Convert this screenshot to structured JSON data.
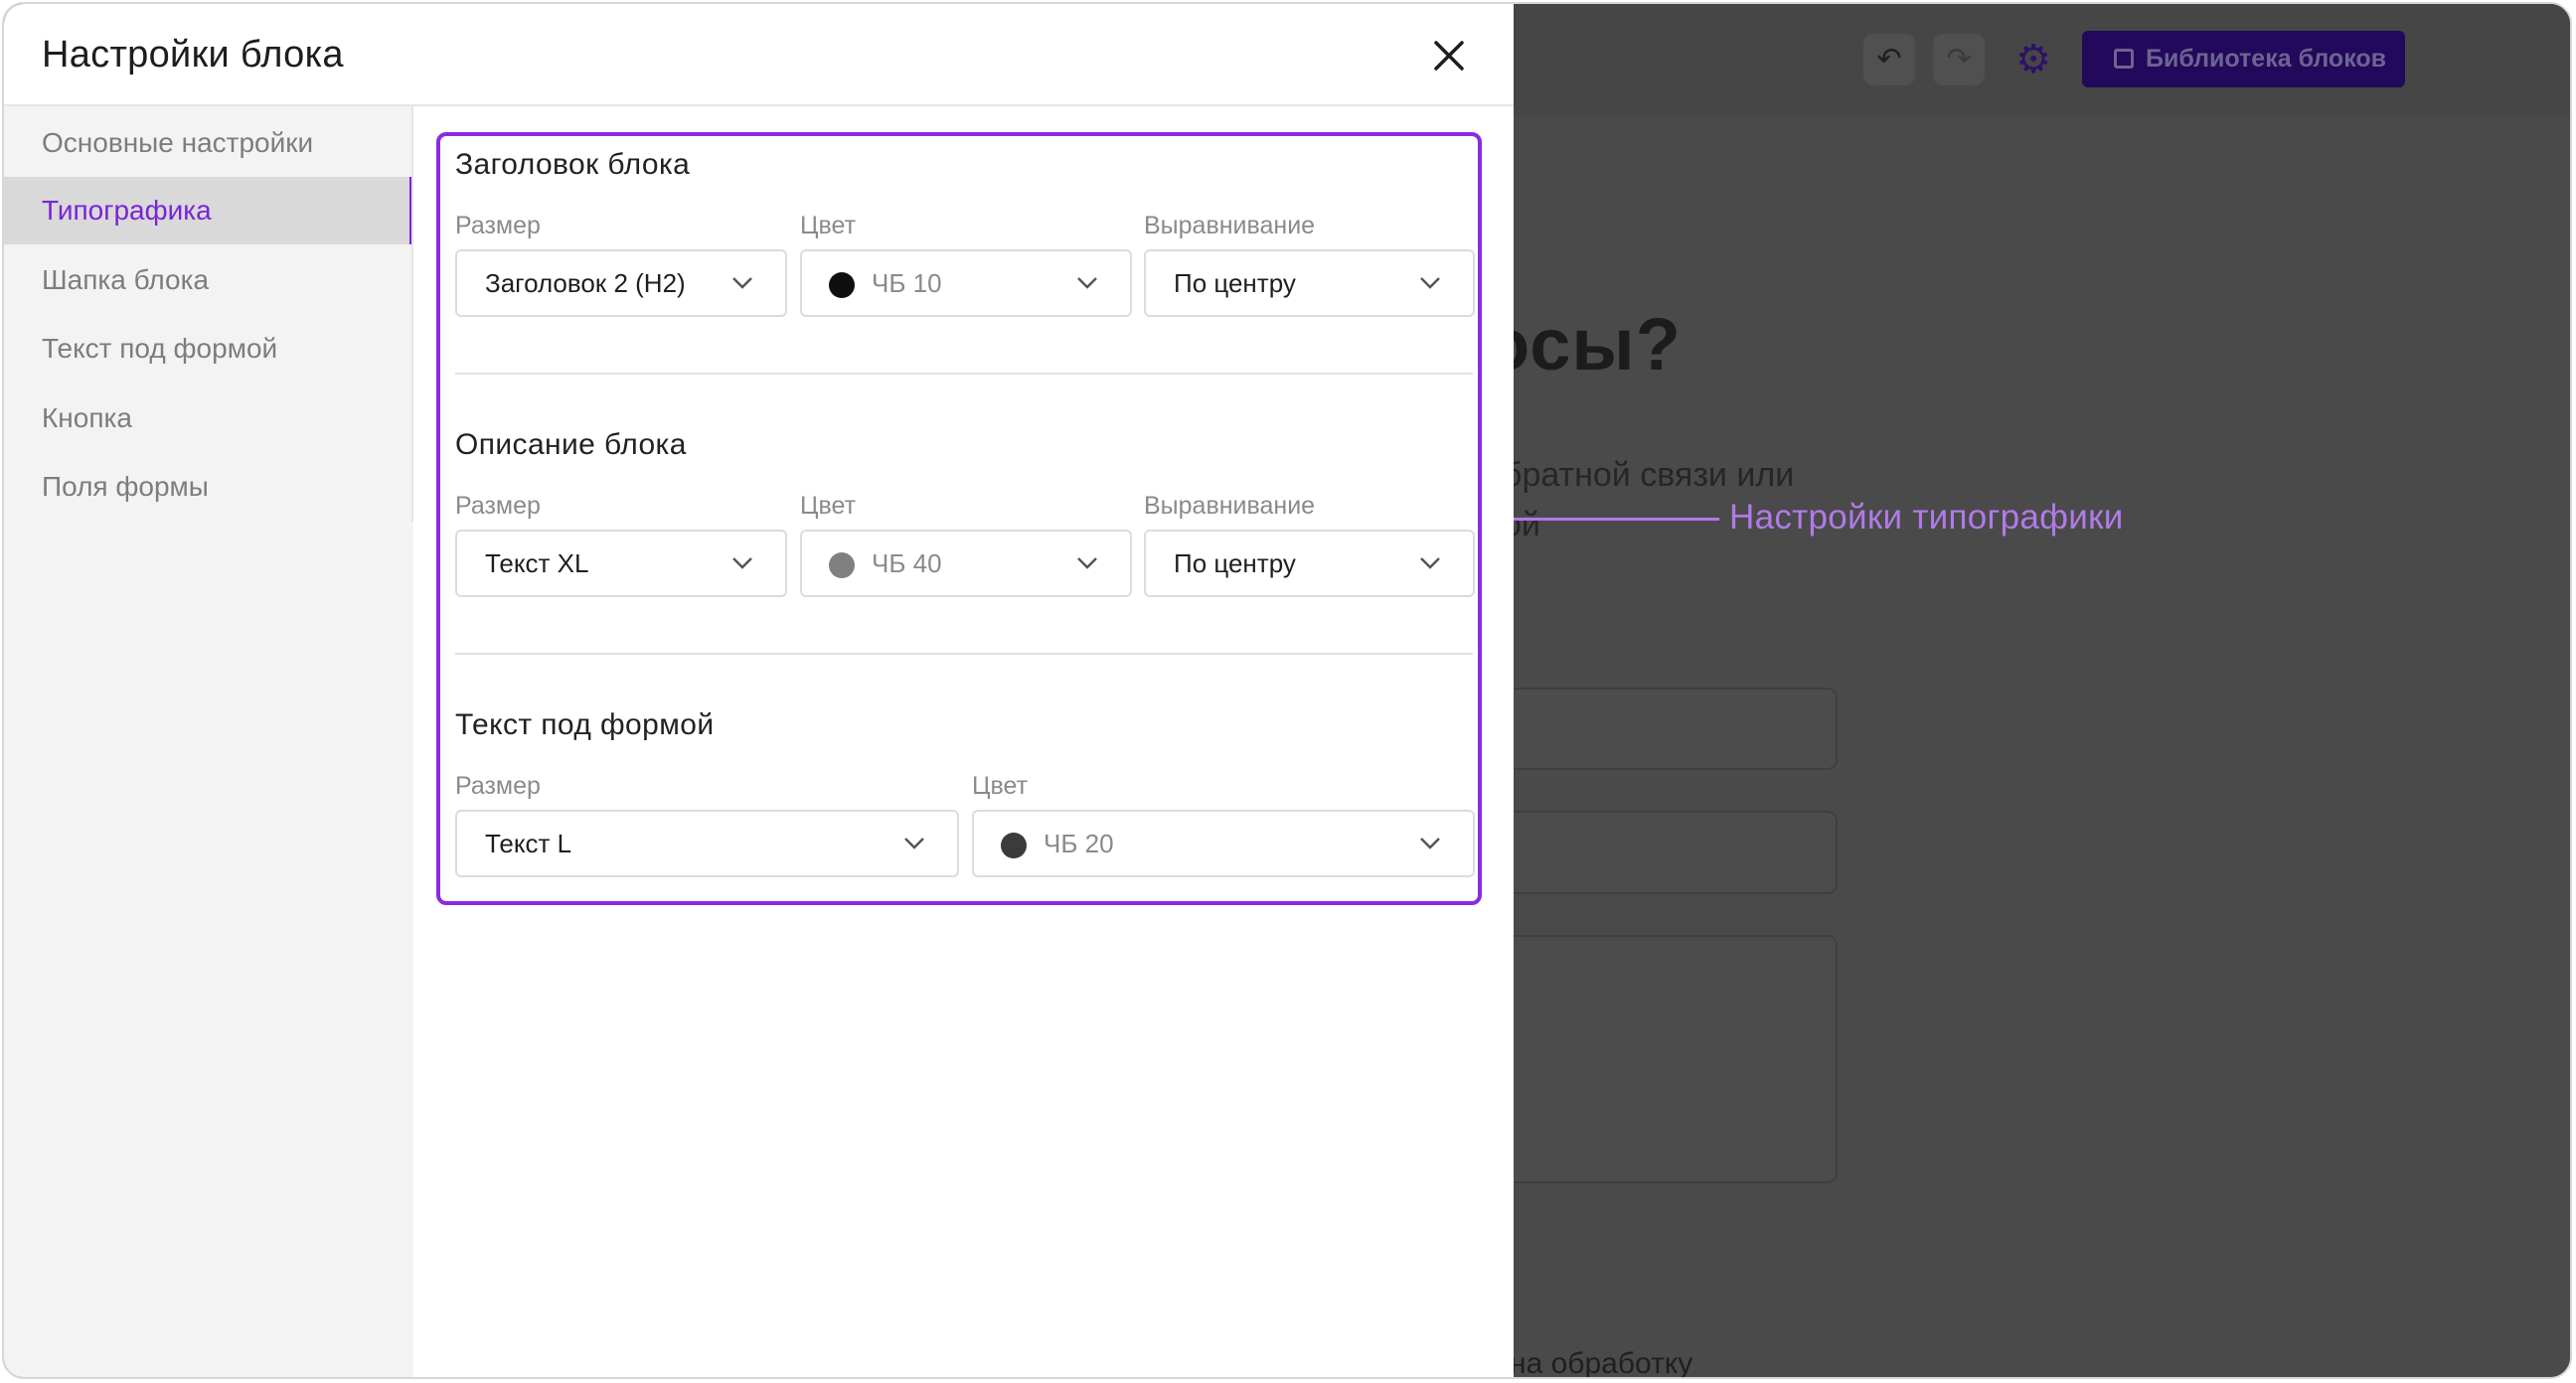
{
  "modal": {
    "title": "Настройки блока"
  },
  "sidebar": {
    "items": [
      {
        "label": "Основные настройки"
      },
      {
        "label": "Типографика"
      },
      {
        "label": "Шапка блока"
      },
      {
        "label": "Текст под формой"
      },
      {
        "label": "Кнопка"
      },
      {
        "label": "Поля формы"
      }
    ],
    "active_index": 1
  },
  "typography": {
    "sections": [
      {
        "title": "Заголовок блока",
        "size_label": "Размер",
        "size_value": "Заголовок 2 (H2)",
        "color_label": "Цвет",
        "color_value": "ЧБ 10",
        "color_swatch": "#0f0f0f",
        "align_label": "Выравнивание",
        "align_value": "По центру"
      },
      {
        "title": "Описание блока",
        "size_label": "Размер",
        "size_value": "Текст XL",
        "color_label": "Цвет",
        "color_value": "ЧБ 40",
        "color_swatch": "#808080",
        "align_label": "Выравнивание",
        "align_value": "По центру"
      },
      {
        "title": "Текст под формой",
        "size_label": "Размер",
        "size_value": "Текст L",
        "color_label": "Цвет",
        "color_value": "ЧБ 20",
        "color_swatch": "#3b3b3b"
      }
    ]
  },
  "annotation": {
    "label": "Настройки типографики",
    "color": "#b07ae8"
  },
  "background_editor": {
    "library_button": "Библиотека блоков",
    "heading_fragment": "осы?",
    "sub_line1_fragment": "братной связи или",
    "sub_line2_fragment": "ой",
    "footer_fragment": "е на обработку"
  },
  "colors": {
    "accent": "#7a24d6",
    "highlight": "#8a2be2"
  }
}
